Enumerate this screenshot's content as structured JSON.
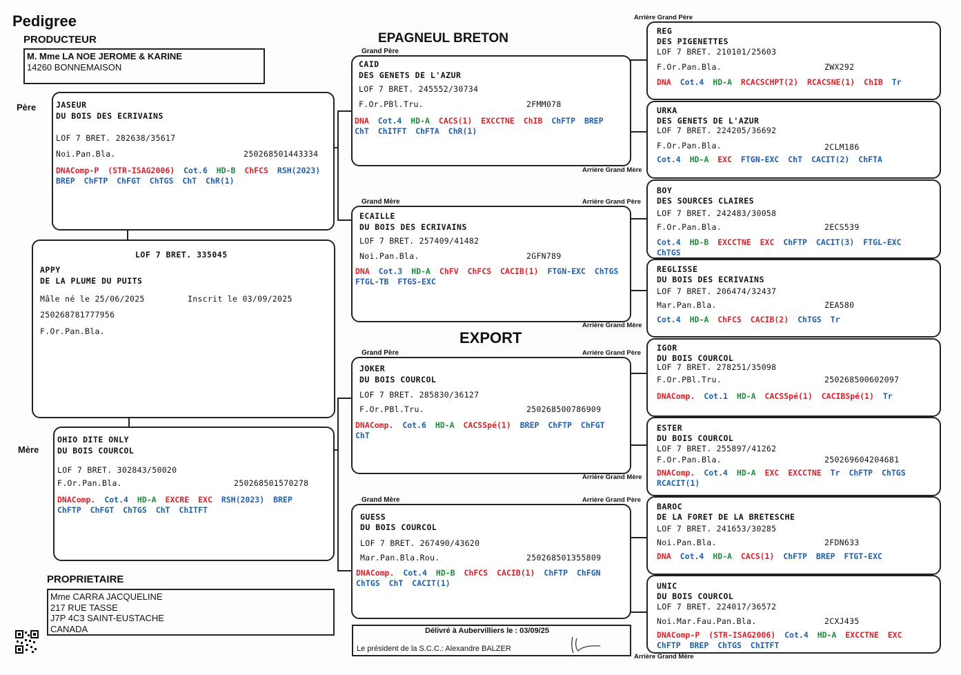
{
  "header": {
    "title": "Pedigree",
    "breed": "EPAGNEUL BRETON",
    "export": "EXPORT",
    "producteur_label": "PRODUCTEUR",
    "producteur_name": "M. Mme LA NOE JEROME & KARINE",
    "producteur_city": "14260 BONNEMAISON"
  },
  "labels": {
    "pere": "Père",
    "mere": "Mère",
    "grand_pere": "Grand Père",
    "grand_mere": "Grand Mère",
    "agp": "Arrière Grand Père",
    "agm": "Arrière Grand Mère"
  },
  "colors": {
    "red": "#d6232a",
    "green": "#1e8c3a",
    "blue": "#1f5fa8",
    "darkred": "#b81f1f"
  },
  "subject": {
    "lof": "LOF 7 BRET. 335045",
    "name1": "APPY",
    "name2": "DE LA PLUME DU PUITS",
    "born": "Mâle né le 25/06/2025",
    "inscrit": "Inscrit le 03/09/2025",
    "chip": "250268781777956",
    "color": "F.Or.Pan.Bla."
  },
  "pere": {
    "name1": "JASEUR",
    "name2": "DU BOIS DES ECRIVAINS",
    "lof": "LOF 7 BRET. 282638/35617",
    "color": "Noi.Pan.Bla.",
    "id": "250268501443334",
    "tags": [
      {
        "t": "DNAComp-P",
        "c": "red"
      },
      {
        "t": "(STR-ISAG2006)",
        "c": "red"
      },
      {
        "t": "Cot.6",
        "c": "blue"
      },
      {
        "t": "HD-B",
        "c": "green"
      },
      {
        "t": "ChFCS",
        "c": "red"
      },
      {
        "t": "RSH(2023)",
        "c": "blue"
      },
      {
        "t": "BREP",
        "c": "blue"
      },
      {
        "t": "ChFTP",
        "c": "blue"
      },
      {
        "t": "ChFGT",
        "c": "blue"
      },
      {
        "t": "ChTGS",
        "c": "blue"
      },
      {
        "t": "ChT",
        "c": "blue"
      },
      {
        "t": "ChR(1)",
        "c": "blue"
      }
    ]
  },
  "mere": {
    "name1": "OHIO DITE ONLY",
    "name2": "DU BOIS COURCOL",
    "lof": "LOF 7 BRET. 302843/50020",
    "color": "F.Or.Pan.Bla.",
    "id": "250268501570278",
    "tags": [
      {
        "t": "DNAComp.",
        "c": "red"
      },
      {
        "t": "Cot.4",
        "c": "blue"
      },
      {
        "t": "HD-A",
        "c": "green"
      },
      {
        "t": "EXCRE",
        "c": "red"
      },
      {
        "t": "EXC",
        "c": "red"
      },
      {
        "t": "RSH(2023)",
        "c": "blue"
      },
      {
        "t": "BREP",
        "c": "blue"
      },
      {
        "t": "ChFTP",
        "c": "blue"
      },
      {
        "t": "ChFGT",
        "c": "blue"
      },
      {
        "t": "ChTGS",
        "c": "blue"
      },
      {
        "t": "ChT",
        "c": "blue"
      },
      {
        "t": "ChITFT",
        "c": "blue"
      }
    ]
  },
  "gp1": {
    "name1": "CAID",
    "name2": "DES GENETS DE L'AZUR",
    "lof": "LOF 7 BRET. 245552/30734",
    "color": "F.Or.PBl.Tru.",
    "id": "2FMM078",
    "tags": [
      {
        "t": "DNA",
        "c": "red"
      },
      {
        "t": "Cot.4",
        "c": "blue"
      },
      {
        "t": "HD-A",
        "c": "green"
      },
      {
        "t": "CACS(1)",
        "c": "red"
      },
      {
        "t": "EXCCTNE",
        "c": "red"
      },
      {
        "t": "ChIB",
        "c": "red"
      },
      {
        "t": "ChFTP",
        "c": "blue"
      },
      {
        "t": "BREP",
        "c": "blue"
      },
      {
        "t": "ChT",
        "c": "blue"
      },
      {
        "t": "ChITFT",
        "c": "blue"
      },
      {
        "t": "ChFTA",
        "c": "blue"
      },
      {
        "t": "ChR(1)",
        "c": "blue"
      }
    ]
  },
  "gm1": {
    "name1": "ECAILLE",
    "name2": "DU BOIS DES ECRIVAINS",
    "lof": "LOF 7 BRET. 257409/41482",
    "color": "Noi.Pan.Bla.",
    "id": "2GFN789",
    "tags": [
      {
        "t": "DNA",
        "c": "red"
      },
      {
        "t": "Cot.3",
        "c": "blue"
      },
      {
        "t": "HD-A",
        "c": "green"
      },
      {
        "t": "ChFV",
        "c": "red"
      },
      {
        "t": "ChFCS",
        "c": "red"
      },
      {
        "t": "CACIB(1)",
        "c": "red"
      },
      {
        "t": "FTGN-EXC",
        "c": "blue"
      },
      {
        "t": "ChTGS",
        "c": "blue"
      },
      {
        "t": "FTGL-TB",
        "c": "blue"
      },
      {
        "t": "FTGS-EXC",
        "c": "blue"
      }
    ]
  },
  "gp2": {
    "name1": "JOKER",
    "name2": "DU BOIS COURCOL",
    "lof": "LOF 7 BRET. 285830/36127",
    "color": "F.Or.PBl.Tru.",
    "id": "250268500786909",
    "tags": [
      {
        "t": "DNAComp.",
        "c": "red"
      },
      {
        "t": "Cot.6",
        "c": "blue"
      },
      {
        "t": "HD-A",
        "c": "green"
      },
      {
        "t": "CACSSpé(1)",
        "c": "red"
      },
      {
        "t": "BREP",
        "c": "blue"
      },
      {
        "t": "ChFTP",
        "c": "blue"
      },
      {
        "t": "ChFGT",
        "c": "blue"
      },
      {
        "t": "ChT",
        "c": "blue"
      }
    ]
  },
  "gm2": {
    "name1": "GUESS",
    "name2": "DU BOIS COURCOL",
    "lof": "LOF 7 BRET. 267490/43620",
    "color": "Mar.Pan.Bla.Rou.",
    "id": "250268501355809",
    "tags": [
      {
        "t": "DNAComp.",
        "c": "red"
      },
      {
        "t": "Cot.4",
        "c": "blue"
      },
      {
        "t": "HD-B",
        "c": "green"
      },
      {
        "t": "ChFCS",
        "c": "red"
      },
      {
        "t": "CACIB(1)",
        "c": "red"
      },
      {
        "t": "ChFTP",
        "c": "blue"
      },
      {
        "t": "ChFGN",
        "c": "blue"
      },
      {
        "t": "ChTGS",
        "c": "blue"
      },
      {
        "t": "ChT",
        "c": "blue"
      },
      {
        "t": "CACIT(1)",
        "c": "blue"
      }
    ]
  },
  "ag": [
    {
      "name1": "REG",
      "name2": "DES PIGENETTES",
      "lof": "LOF 7 BRET. 210101/25603",
      "color": "F.Or.Pan.Bla.",
      "id": "ZWX292",
      "tags": [
        {
          "t": "DNA",
          "c": "red"
        },
        {
          "t": "Cot.4",
          "c": "blue"
        },
        {
          "t": "HD-A",
          "c": "green"
        },
        {
          "t": "RCACSCHPT(2)",
          "c": "red"
        },
        {
          "t": "RCACSNE(1)",
          "c": "red"
        },
        {
          "t": "ChIB",
          "c": "red"
        },
        {
          "t": "Tr",
          "c": "blue"
        }
      ]
    },
    {
      "name1": "URKA",
      "name2": "DES GENETS DE L'AZUR",
      "lof": "LOF 7 BRET. 224205/36692",
      "color": "F.Or.Pan.Bla.",
      "id": "2CLM186",
      "tags": [
        {
          "t": "Cot.4",
          "c": "blue"
        },
        {
          "t": "HD-A",
          "c": "green"
        },
        {
          "t": "EXC",
          "c": "red"
        },
        {
          "t": "FTGN-EXC",
          "c": "blue"
        },
        {
          "t": "ChT",
          "c": "blue"
        },
        {
          "t": "CACIT(2)",
          "c": "blue"
        },
        {
          "t": "ChFTA",
          "c": "blue"
        }
      ]
    },
    {
      "name1": "BOY",
      "name2": "DES SOURCES CLAIRES",
      "lof": "LOF 7 BRET. 242483/30058",
      "color": "F.Or.Pan.Bla.",
      "id": "2ECS539",
      "tags": [
        {
          "t": "Cot.4",
          "c": "blue"
        },
        {
          "t": "HD-B",
          "c": "green"
        },
        {
          "t": "EXCCTNE",
          "c": "red"
        },
        {
          "t": "EXC",
          "c": "red"
        },
        {
          "t": "ChFTP",
          "c": "blue"
        },
        {
          "t": "CACIT(3)",
          "c": "blue"
        },
        {
          "t": "FTGL-EXC",
          "c": "blue"
        },
        {
          "t": "ChTGS",
          "c": "blue"
        }
      ]
    },
    {
      "name1": "REGLISSE",
      "name2": "DU BOIS DES ECRIVAINS",
      "lof": "LOF 7 BRET. 206474/32437",
      "color": "Mar.Pan.Bla.",
      "id": "ZEA580",
      "tags": [
        {
          "t": "Cot.4",
          "c": "blue"
        },
        {
          "t": "HD-A",
          "c": "green"
        },
        {
          "t": "ChFCS",
          "c": "red"
        },
        {
          "t": "CACIB(2)",
          "c": "red"
        },
        {
          "t": "ChTGS",
          "c": "blue"
        },
        {
          "t": "Tr",
          "c": "blue"
        }
      ]
    },
    {
      "name1": "IGOR",
      "name2": "DU BOIS COURCOL",
      "lof": "LOF 7 BRET. 278251/35098",
      "color": "F.Or.PBl.Tru.",
      "id": "250268500602097",
      "tags": [
        {
          "t": "DNAComp.",
          "c": "red"
        },
        {
          "t": "Cot.1",
          "c": "blue"
        },
        {
          "t": "HD-A",
          "c": "green"
        },
        {
          "t": "CACSSpé(1)",
          "c": "red"
        },
        {
          "t": "CACIBSpé(1)",
          "c": "red"
        },
        {
          "t": "Tr",
          "c": "blue"
        }
      ]
    },
    {
      "name1": "ESTER",
      "name2": "DU BOIS COURCOL",
      "lof": "LOF 7 BRET. 255897/41262",
      "color": "F.Or.Pan.Bla.",
      "id": "250269604204681",
      "tags": [
        {
          "t": "DNAComp.",
          "c": "red"
        },
        {
          "t": "Cot.4",
          "c": "blue"
        },
        {
          "t": "HD-A",
          "c": "green"
        },
        {
          "t": "EXC",
          "c": "red"
        },
        {
          "t": "EXCCTNE",
          "c": "red"
        },
        {
          "t": "Tr",
          "c": "blue"
        },
        {
          "t": "ChFTP",
          "c": "blue"
        },
        {
          "t": "ChTGS",
          "c": "blue"
        },
        {
          "t": "RCACIT(1)",
          "c": "blue"
        }
      ]
    },
    {
      "name1": "BAROC",
      "name2": "DE LA FORET DE LA BRETESCHE",
      "lof": "LOF 7 BRET. 241653/30285",
      "color": "Noi.Pan.Bla.",
      "id": "2FDN633",
      "tags": [
        {
          "t": "DNA",
          "c": "red"
        },
        {
          "t": "Cot.4",
          "c": "blue"
        },
        {
          "t": "HD-A",
          "c": "green"
        },
        {
          "t": "CACS(1)",
          "c": "red"
        },
        {
          "t": "ChFTP",
          "c": "blue"
        },
        {
          "t": "BREP",
          "c": "blue"
        },
        {
          "t": "FTGT-EXC",
          "c": "blue"
        }
      ]
    },
    {
      "name1": "UNIC",
      "name2": "DU BOIS COURCOL",
      "lof": "LOF 7 BRET. 224017/36572",
      "color": "Noi.Mar.Fau.Pan.Bla.",
      "id": "2CXJ435",
      "tags": [
        {
          "t": "DNAComp-P",
          "c": "red"
        },
        {
          "t": "(STR-ISAG2006)",
          "c": "red"
        },
        {
          "t": "Cot.4",
          "c": "blue"
        },
        {
          "t": "HD-A",
          "c": "green"
        },
        {
          "t": "EXCCTNE",
          "c": "red"
        },
        {
          "t": "EXC",
          "c": "red"
        },
        {
          "t": "ChFTP",
          "c": "blue"
        },
        {
          "t": "BREP",
          "c": "blue"
        },
        {
          "t": "ChTGS",
          "c": "blue"
        },
        {
          "t": "ChITFT",
          "c": "blue"
        }
      ]
    }
  ],
  "proprietaire": {
    "label": "PROPRIETAIRE",
    "l1": "Mme CARRA JACQUELINE",
    "l2": "217 RUE TASSE",
    "l3": "J7P 4C3 SAINT-EUSTACHE",
    "l4": "CANADA"
  },
  "footer": {
    "delivre": "Délivré à Aubervilliers le : 03/09/25",
    "president": "Le président de la S.C.C.: Alexandre BALZER"
  }
}
